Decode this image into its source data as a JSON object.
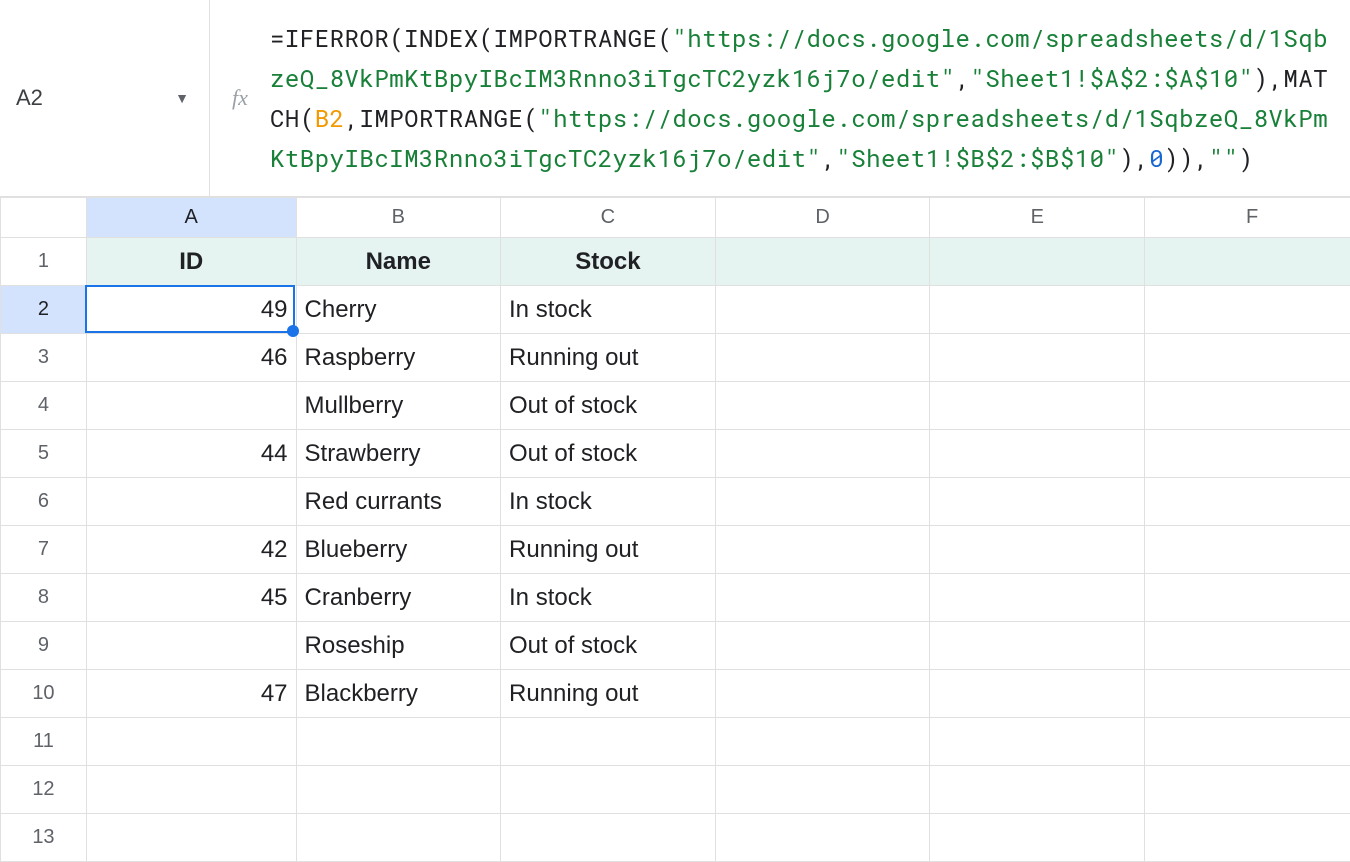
{
  "nameBox": "A2",
  "formula": {
    "tokens": [
      {
        "t": "=",
        "c": "fn"
      },
      {
        "t": "IFERROR",
        "c": "fn"
      },
      {
        "t": "(",
        "c": "fn"
      },
      {
        "t": "INDEX",
        "c": "fn"
      },
      {
        "t": "(",
        "c": "fn"
      },
      {
        "t": "IMPORTRANGE",
        "c": "fn"
      },
      {
        "t": "(",
        "c": "fn"
      },
      {
        "t": "\"https://docs.google.com/spreadsheets/d/1SqbzeQ_8VkPmKtBpyIBcIM3Rnno3iTgcTC2yzk16j7o/edit\"",
        "c": "str"
      },
      {
        "t": ",",
        "c": "fn"
      },
      {
        "t": "\"Sheet1!$A$2:$A$10\"",
        "c": "str"
      },
      {
        "t": ")",
        "c": "fn"
      },
      {
        "t": ",",
        "c": "fn"
      },
      {
        "t": "MATCH",
        "c": "fn"
      },
      {
        "t": "(",
        "c": "fn"
      },
      {
        "t": "B2",
        "c": "ref"
      },
      {
        "t": ",",
        "c": "fn"
      },
      {
        "t": "IMPORTRANGE",
        "c": "fn"
      },
      {
        "t": "(",
        "c": "fn"
      },
      {
        "t": "\"https://docs.google.com/spreadsheets/d/1SqbzeQ_8VkPmKtBpyIBcIM3Rnno3iTgcTC2yzk16j7o/edit\"",
        "c": "str"
      },
      {
        "t": ",",
        "c": "fn"
      },
      {
        "t": "\"Sheet1!$B$2:$B$10\"",
        "c": "str"
      },
      {
        "t": ")",
        "c": "fn"
      },
      {
        "t": ",",
        "c": "fn"
      },
      {
        "t": "0",
        "c": "num"
      },
      {
        "t": ")",
        "c": "fn"
      },
      {
        "t": ")",
        "c": "fn"
      },
      {
        "t": ",",
        "c": "fn"
      },
      {
        "t": "\"\"",
        "c": "str"
      },
      {
        "t": ")",
        "c": "fn"
      }
    ]
  },
  "columns": [
    "A",
    "B",
    "C",
    "D",
    "E",
    "F"
  ],
  "headers": {
    "A": "ID",
    "B": "Name",
    "C": "Stock"
  },
  "rows": [
    {
      "n": 1,
      "A": "",
      "B": "",
      "C": ""
    },
    {
      "n": 2,
      "A": "49",
      "B": "Cherry",
      "C": "In stock"
    },
    {
      "n": 3,
      "A": "46",
      "B": "Raspberry",
      "C": "Running out"
    },
    {
      "n": 4,
      "A": "",
      "B": "Mullberry",
      "C": "Out of stock"
    },
    {
      "n": 5,
      "A": "44",
      "B": "Strawberry",
      "C": "Out of stock"
    },
    {
      "n": 6,
      "A": "",
      "B": "Red currants",
      "C": "In stock"
    },
    {
      "n": 7,
      "A": "42",
      "B": "Blueberry",
      "C": "Running out"
    },
    {
      "n": 8,
      "A": "45",
      "B": "Cranberry",
      "C": "In stock"
    },
    {
      "n": 9,
      "A": "",
      "B": "Roseship",
      "C": "Out of stock"
    },
    {
      "n": 10,
      "A": "47",
      "B": "Blackberry",
      "C": "Running out"
    },
    {
      "n": 11,
      "A": "",
      "B": "",
      "C": ""
    },
    {
      "n": 12,
      "A": "",
      "B": "",
      "C": ""
    },
    {
      "n": 13,
      "A": "",
      "B": "",
      "C": ""
    }
  ],
  "activeCell": {
    "col": "A",
    "row": 2
  },
  "chart_data": {
    "type": "table",
    "columns": [
      "ID",
      "Name",
      "Stock"
    ],
    "rows": [
      [
        "49",
        "Cherry",
        "In stock"
      ],
      [
        "46",
        "Raspberry",
        "Running out"
      ],
      [
        "",
        "Mullberry",
        "Out of stock"
      ],
      [
        "44",
        "Strawberry",
        "Out of stock"
      ],
      [
        "",
        "Red currants",
        "In stock"
      ],
      [
        "42",
        "Blueberry",
        "Running out"
      ],
      [
        "45",
        "Cranberry",
        "In stock"
      ],
      [
        "",
        "Roseship",
        "Out of stock"
      ],
      [
        "47",
        "Blackberry",
        "Running out"
      ]
    ]
  }
}
